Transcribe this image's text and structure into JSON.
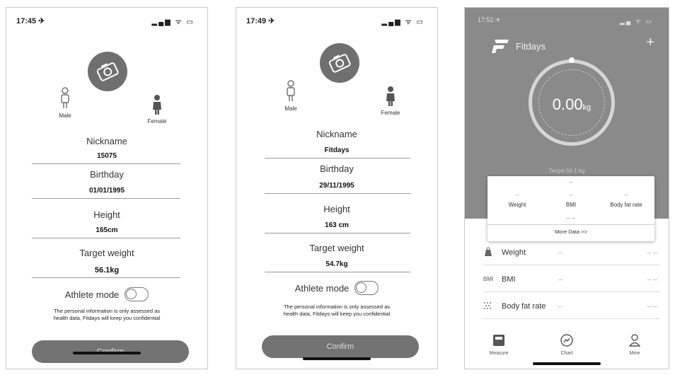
{
  "phone1": {
    "status": {
      "time": "17:45 ✈",
      "icons": "▂▄▆ ᯤ ▭"
    },
    "gender": {
      "male": "Male",
      "female": "Female"
    },
    "fields": [
      {
        "title": "Nickname",
        "value": "15075"
      },
      {
        "title": "Birthday",
        "value": "01/01/1995"
      },
      {
        "title": "Height",
        "value": "165cm"
      },
      {
        "title": "Target weight",
        "value": "56.1kg"
      }
    ],
    "athlete_label": "Athlete mode",
    "info_line1": "The personal information is only assessed as",
    "info_line2": "health data, Fitdays will keep you confidential",
    "confirm": "Confirm"
  },
  "phone2": {
    "status": {
      "time": "17:49 ✈",
      "icons": "▂▄▆ ᯤ ▭"
    },
    "gender": {
      "male": "Male",
      "female": "Female"
    },
    "fields": [
      {
        "title": "Nickname",
        "value": "Fitdays"
      },
      {
        "title": "Birthday",
        "value": "29/11/1995"
      },
      {
        "title": "Height",
        "value": "163 cm"
      },
      {
        "title": "Target weight",
        "value": "54.7kg"
      }
    ],
    "athlete_label": "Athlete mode",
    "info_line1": "The personal information is only assessed as",
    "info_line2": "health data, Fitdays will keep you confidential",
    "confirm": "Confirm"
  },
  "phone3": {
    "status": {
      "time": "17:52 ✈",
      "icons": "▂▄ ᯤ ▭"
    },
    "app_name": "Fitdays",
    "plus": "+",
    "weight_value": "0.00",
    "weight_unit": "kg",
    "target": "Target:56.1 kg",
    "card": {
      "top_dash": "--",
      "cols": [
        {
          "dash": "--",
          "label": "Weight"
        },
        {
          "dash": "--",
          "label": "BMI"
        },
        {
          "dash": "--",
          "label": "Body fat rate"
        }
      ],
      "mid_dash": "-- --",
      "more": "More Data >>"
    },
    "rows": [
      {
        "icon": "weight-icon",
        "icon_text": "",
        "label": "Weight",
        "dash": "--",
        "value": "-- --"
      },
      {
        "icon": "bmi-icon",
        "icon_text": "BMI",
        "label": "BMI",
        "dash": "--",
        "value": "-- --"
      },
      {
        "icon": "body-fat-icon",
        "icon_text": "",
        "label": "Body fat rate",
        "dash": "--",
        "value": "-- --"
      }
    ],
    "tabs": [
      {
        "label": "Measure",
        "icon": "scale-icon"
      },
      {
        "label": "Chart",
        "icon": "chart-icon"
      },
      {
        "label": "Mine",
        "icon": "person-icon"
      }
    ]
  }
}
